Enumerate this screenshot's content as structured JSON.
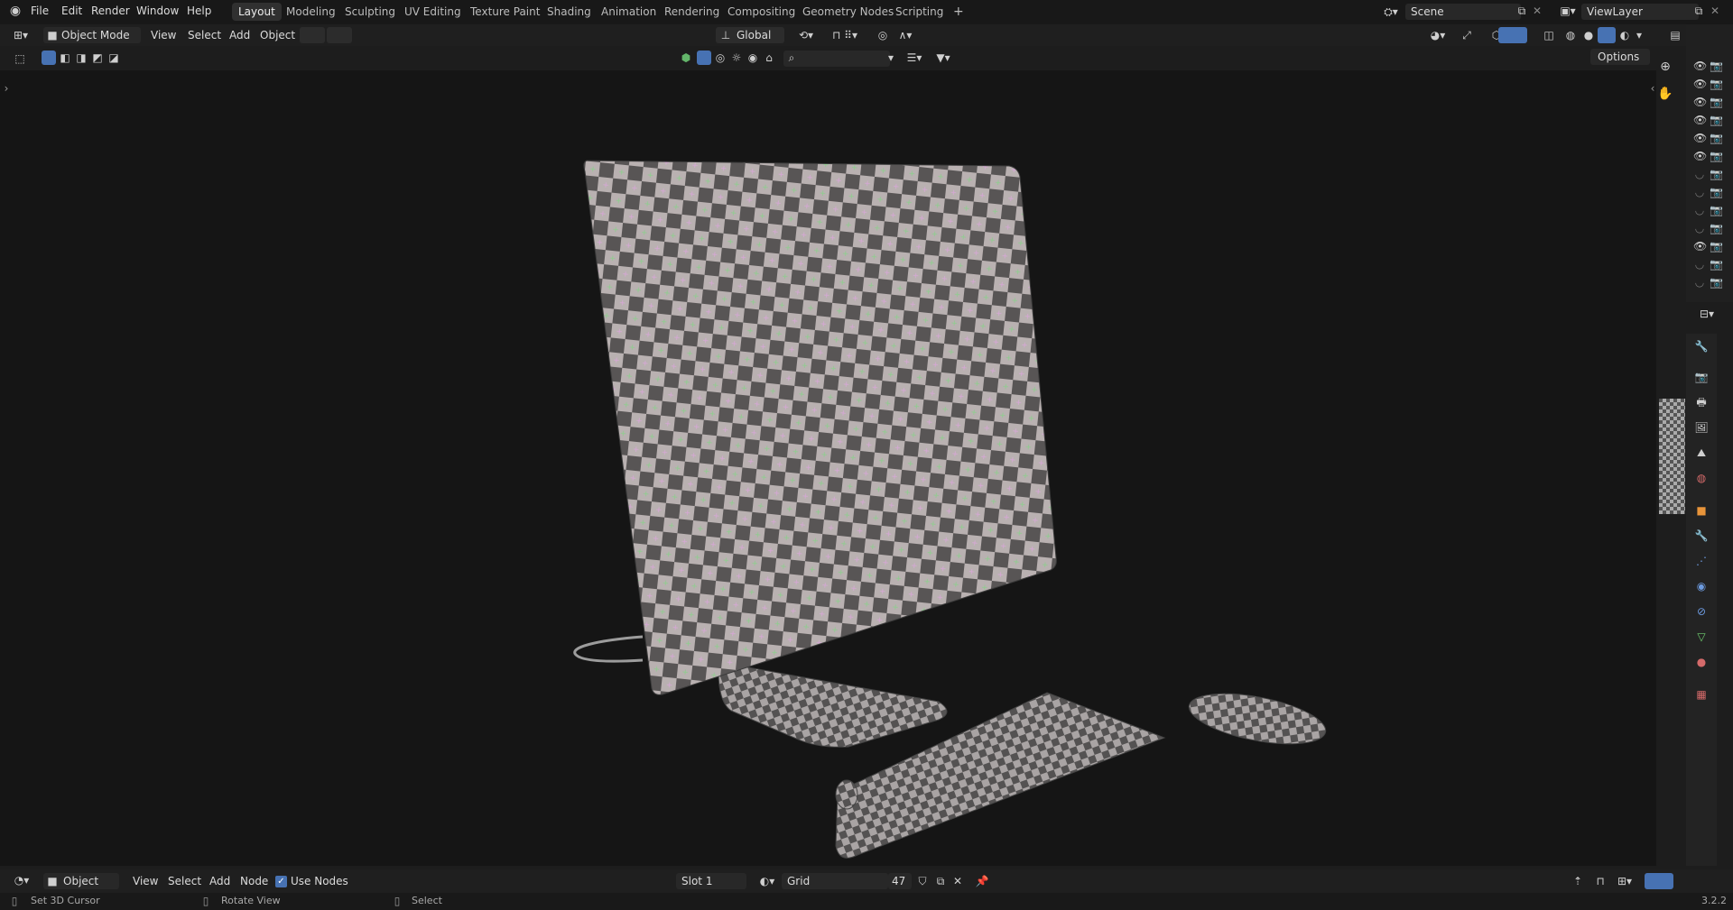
{
  "menubar": {
    "items": [
      "File",
      "Edit",
      "Render",
      "Window",
      "Help"
    ],
    "workspaces": [
      "Layout",
      "Modeling",
      "Sculpting",
      "UV Editing",
      "Texture Paint",
      "Shading",
      "Animation",
      "Rendering",
      "Compositing",
      "Geometry Nodes",
      "Scripting"
    ],
    "active_workspace": "Layout",
    "add_tab_label": "+",
    "scene_label": "Scene",
    "view_layer_label": "ViewLayer"
  },
  "viewport_header": {
    "mode_label": "Object Mode",
    "menu": [
      "View",
      "Select",
      "Add",
      "Object"
    ],
    "transform_orientation": "Global",
    "options_label": "Options"
  },
  "node_editor_header": {
    "context_label": "Object",
    "menu": [
      "View",
      "Select",
      "Add",
      "Node"
    ],
    "use_nodes_label": "Use Nodes",
    "use_nodes_checked": true,
    "slot_label": "Slot 1",
    "material_name": "Grid",
    "user_count": "47"
  },
  "statusbar": {
    "left_action": "Set 3D Cursor",
    "middle_action": "Rotate View",
    "right_action": "Select",
    "version": "3.2.2"
  },
  "outliner": {
    "rows": [
      {
        "visible": true
      },
      {
        "visible": true
      },
      {
        "visible": true
      },
      {
        "visible": true
      },
      {
        "visible": true
      },
      {
        "visible": true
      },
      {
        "visible": false
      },
      {
        "visible": false
      },
      {
        "visible": false
      },
      {
        "visible": false
      },
      {
        "visible": true
      },
      {
        "visible": false
      },
      {
        "visible": false
      }
    ]
  },
  "colors": {
    "accent_blue": "#4772b3",
    "checker_light": "#b9b1b1",
    "checker_dark": "#585555"
  }
}
